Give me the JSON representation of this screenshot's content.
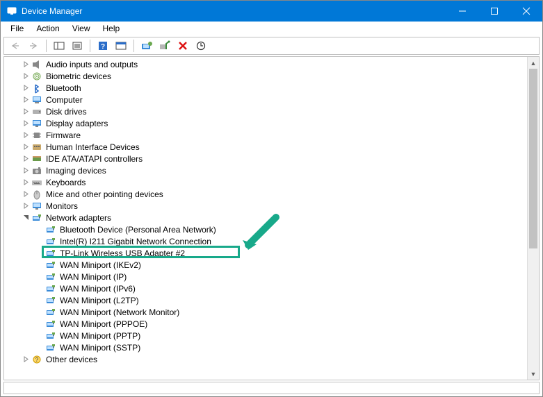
{
  "window": {
    "title": "Device Manager"
  },
  "menu": {
    "items": [
      "File",
      "Action",
      "View",
      "Help"
    ]
  },
  "tree": {
    "categories": [
      {
        "label": "Audio inputs and outputs",
        "icon": "speaker",
        "expanded": false
      },
      {
        "label": "Biometric devices",
        "icon": "fingerprint",
        "expanded": false
      },
      {
        "label": "Bluetooth",
        "icon": "bluetooth",
        "expanded": false
      },
      {
        "label": "Computer",
        "icon": "computer",
        "expanded": false
      },
      {
        "label": "Disk drives",
        "icon": "disk",
        "expanded": false
      },
      {
        "label": "Display adapters",
        "icon": "display",
        "expanded": false
      },
      {
        "label": "Firmware",
        "icon": "chip",
        "expanded": false
      },
      {
        "label": "Human Interface Devices",
        "icon": "hid",
        "expanded": false
      },
      {
        "label": "IDE ATA/ATAPI controllers",
        "icon": "ide",
        "expanded": false
      },
      {
        "label": "Imaging devices",
        "icon": "camera",
        "expanded": false
      },
      {
        "label": "Keyboards",
        "icon": "keyboard",
        "expanded": false
      },
      {
        "label": "Mice and other pointing devices",
        "icon": "mouse",
        "expanded": false
      },
      {
        "label": "Monitors",
        "icon": "monitor",
        "expanded": false
      },
      {
        "label": "Network adapters",
        "icon": "network",
        "expanded": true,
        "children": [
          {
            "label": "Bluetooth Device (Personal Area Network)",
            "icon": "network"
          },
          {
            "label": "Intel(R) I211 Gigabit Network Connection",
            "icon": "network"
          },
          {
            "label": "TP-Link Wireless USB Adapter #2",
            "icon": "network",
            "highlighted": true
          },
          {
            "label": "WAN Miniport (IKEv2)",
            "icon": "network"
          },
          {
            "label": "WAN Miniport (IP)",
            "icon": "network"
          },
          {
            "label": "WAN Miniport (IPv6)",
            "icon": "network"
          },
          {
            "label": "WAN Miniport (L2TP)",
            "icon": "network"
          },
          {
            "label": "WAN Miniport (Network Monitor)",
            "icon": "network"
          },
          {
            "label": "WAN Miniport (PPPOE)",
            "icon": "network"
          },
          {
            "label": "WAN Miniport (PPTP)",
            "icon": "network"
          },
          {
            "label": "WAN Miniport (SSTP)",
            "icon": "network"
          }
        ]
      },
      {
        "label": "Other devices",
        "icon": "other",
        "expanded": false
      }
    ]
  }
}
